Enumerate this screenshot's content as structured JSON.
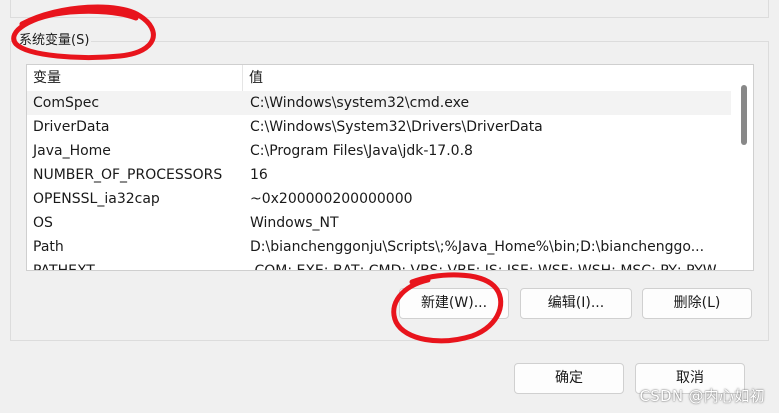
{
  "section": {
    "label": "系统变量(S)"
  },
  "table": {
    "headers": [
      "变量",
      "值"
    ],
    "rows": [
      {
        "name": "ComSpec",
        "value": "C:\\Windows\\system32\\cmd.exe"
      },
      {
        "name": "DriverData",
        "value": "C:\\Windows\\System32\\Drivers\\DriverData"
      },
      {
        "name": "Java_Home",
        "value": "C:\\Program Files\\Java\\jdk-17.0.8"
      },
      {
        "name": "NUMBER_OF_PROCESSORS",
        "value": "16"
      },
      {
        "name": "OPENSSL_ia32cap",
        "value": "~0x200000200000000"
      },
      {
        "name": "OS",
        "value": "Windows_NT"
      },
      {
        "name": "Path",
        "value": "D:\\bianchenggonju\\Scripts\\;%Java_Home%\\bin;D:\\bianchenggo..."
      },
      {
        "name": "PATHEXT",
        "value": ".COM;.EXE;.BAT;.CMD;.VBS;.VBE;.JS;.JSE;.WSF;.WSH;.MSC;.PY;.PYW"
      }
    ],
    "selected_row": 0
  },
  "buttons": {
    "new": "新建(W)...",
    "edit": "编辑(I)...",
    "delete": "删除(L)",
    "ok": "确定",
    "cancel": "取消"
  },
  "watermark": "CSDN @内心如初",
  "colors": {
    "annotation": "#e8141c",
    "selected_row": "#f3f3f3"
  }
}
